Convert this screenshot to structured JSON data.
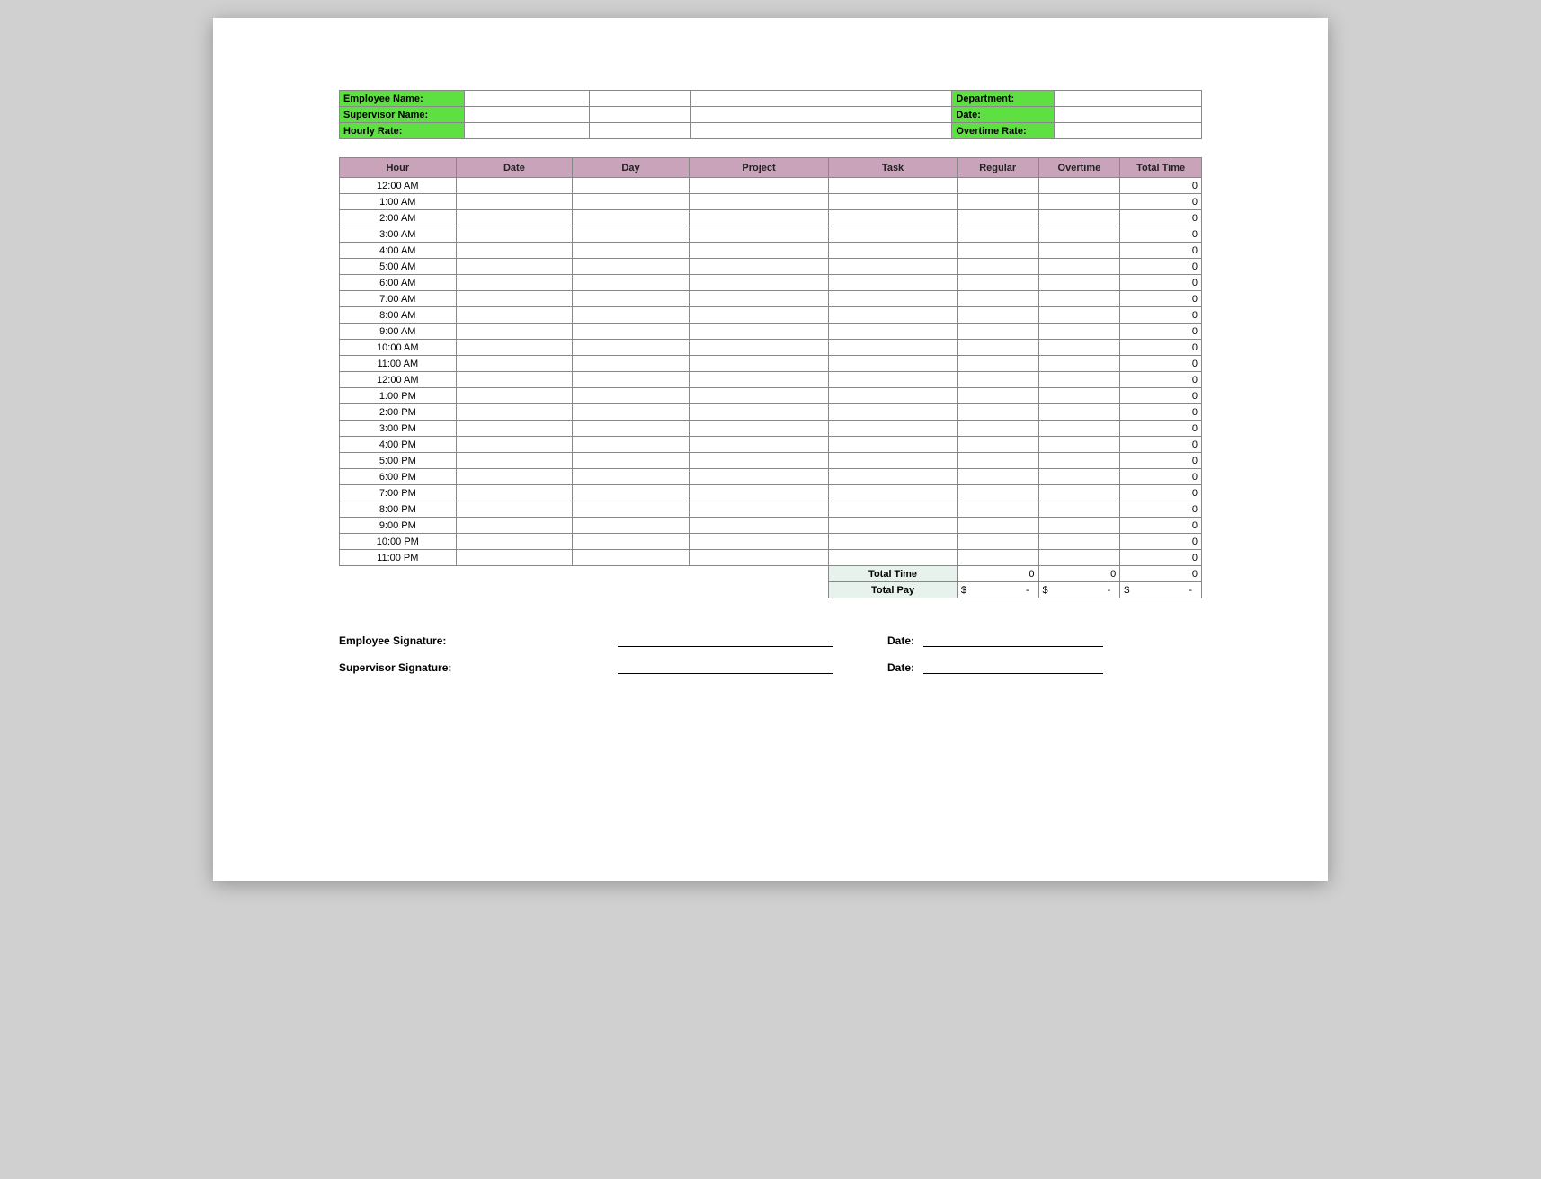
{
  "info": {
    "employee_name_label": "Employee Name:",
    "supervisor_name_label": "Supervisor Name:",
    "hourly_rate_label": "Hourly Rate:",
    "department_label": "Department:",
    "date_label": "Date:",
    "overtime_rate_label": "Overtime Rate:",
    "employee_name": "",
    "supervisor_name": "",
    "hourly_rate": "",
    "department": "",
    "date": "",
    "overtime_rate": ""
  },
  "columns": {
    "hour": "Hour",
    "date": "Date",
    "day": "Day",
    "project": "Project",
    "task": "Task",
    "regular": "Regular",
    "overtime": "Overtime",
    "total": "Total Time"
  },
  "rows": [
    {
      "hour": "12:00 AM",
      "date": "",
      "day": "",
      "project": "",
      "task": "",
      "regular": "",
      "overtime": "",
      "total": "0"
    },
    {
      "hour": "1:00 AM",
      "date": "",
      "day": "",
      "project": "",
      "task": "",
      "regular": "",
      "overtime": "",
      "total": "0"
    },
    {
      "hour": "2:00 AM",
      "date": "",
      "day": "",
      "project": "",
      "task": "",
      "regular": "",
      "overtime": "",
      "total": "0"
    },
    {
      "hour": "3:00 AM",
      "date": "",
      "day": "",
      "project": "",
      "task": "",
      "regular": "",
      "overtime": "",
      "total": "0"
    },
    {
      "hour": "4:00 AM",
      "date": "",
      "day": "",
      "project": "",
      "task": "",
      "regular": "",
      "overtime": "",
      "total": "0"
    },
    {
      "hour": "5:00 AM",
      "date": "",
      "day": "",
      "project": "",
      "task": "",
      "regular": "",
      "overtime": "",
      "total": "0"
    },
    {
      "hour": "6:00 AM",
      "date": "",
      "day": "",
      "project": "",
      "task": "",
      "regular": "",
      "overtime": "",
      "total": "0"
    },
    {
      "hour": "7:00 AM",
      "date": "",
      "day": "",
      "project": "",
      "task": "",
      "regular": "",
      "overtime": "",
      "total": "0"
    },
    {
      "hour": "8:00 AM",
      "date": "",
      "day": "",
      "project": "",
      "task": "",
      "regular": "",
      "overtime": "",
      "total": "0"
    },
    {
      "hour": "9:00 AM",
      "date": "",
      "day": "",
      "project": "",
      "task": "",
      "regular": "",
      "overtime": "",
      "total": "0"
    },
    {
      "hour": "10:00 AM",
      "date": "",
      "day": "",
      "project": "",
      "task": "",
      "regular": "",
      "overtime": "",
      "total": "0"
    },
    {
      "hour": "11:00 AM",
      "date": "",
      "day": "",
      "project": "",
      "task": "",
      "regular": "",
      "overtime": "",
      "total": "0"
    },
    {
      "hour": "12:00 AM",
      "date": "",
      "day": "",
      "project": "",
      "task": "",
      "regular": "",
      "overtime": "",
      "total": "0"
    },
    {
      "hour": "1:00 PM",
      "date": "",
      "day": "",
      "project": "",
      "task": "",
      "regular": "",
      "overtime": "",
      "total": "0"
    },
    {
      "hour": "2:00 PM",
      "date": "",
      "day": "",
      "project": "",
      "task": "",
      "regular": "",
      "overtime": "",
      "total": "0"
    },
    {
      "hour": "3:00 PM",
      "date": "",
      "day": "",
      "project": "",
      "task": "",
      "regular": "",
      "overtime": "",
      "total": "0"
    },
    {
      "hour": "4:00 PM",
      "date": "",
      "day": "",
      "project": "",
      "task": "",
      "regular": "",
      "overtime": "",
      "total": "0"
    },
    {
      "hour": "5:00 PM",
      "date": "",
      "day": "",
      "project": "",
      "task": "",
      "regular": "",
      "overtime": "",
      "total": "0"
    },
    {
      "hour": "6:00 PM",
      "date": "",
      "day": "",
      "project": "",
      "task": "",
      "regular": "",
      "overtime": "",
      "total": "0"
    },
    {
      "hour": "7:00 PM",
      "date": "",
      "day": "",
      "project": "",
      "task": "",
      "regular": "",
      "overtime": "",
      "total": "0"
    },
    {
      "hour": "8:00 PM",
      "date": "",
      "day": "",
      "project": "",
      "task": "",
      "regular": "",
      "overtime": "",
      "total": "0"
    },
    {
      "hour": "9:00 PM",
      "date": "",
      "day": "",
      "project": "",
      "task": "",
      "regular": "",
      "overtime": "",
      "total": "0"
    },
    {
      "hour": "10:00 PM",
      "date": "",
      "day": "",
      "project": "",
      "task": "",
      "regular": "",
      "overtime": "",
      "total": "0"
    },
    {
      "hour": "11:00 PM",
      "date": "",
      "day": "",
      "project": "",
      "task": "",
      "regular": "",
      "overtime": "",
      "total": "0"
    }
  ],
  "summary": {
    "total_time_label": "Total Time",
    "total_pay_label": "Total Pay",
    "regular_total": "0",
    "overtime_total": "0",
    "grand_total": "0",
    "pay_currency": "$",
    "pay_dash": "-"
  },
  "signatures": {
    "employee_label": "Employee Signature:",
    "supervisor_label": "Supervisor Signature:",
    "date_label": "Date:"
  }
}
